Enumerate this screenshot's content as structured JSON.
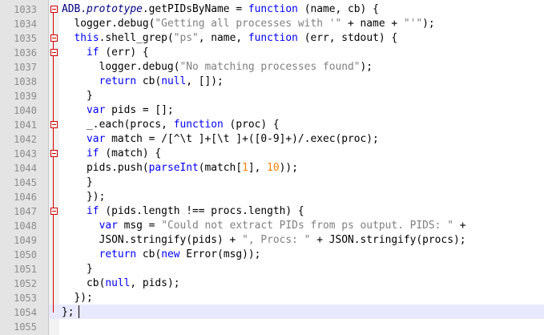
{
  "editor": {
    "caret_line": "1054",
    "lines": [
      {
        "n": "1033",
        "fold": true,
        "tokens": [
          [
            "ADB.",
            "op"
          ],
          [
            "prototype",
            "it"
          ],
          [
            ".getPIDsByName = ",
            ""
          ],
          [
            "function",
            ""
          ],
          [
            " (name, cb) {",
            ""
          ]
        ]
      },
      {
        "n": "1034",
        "fold": false,
        "tokens": [
          [
            "  logger.debug(",
            ""
          ],
          [
            "\"Getting all processes with '\"",
            "str"
          ],
          [
            " + name + ",
            ""
          ],
          [
            "\"'\"",
            "str"
          ],
          [
            ");",
            ""
          ]
        ]
      },
      {
        "n": "1035",
        "fold": true,
        "tokens": [
          [
            "  ",
            ""
          ],
          [
            "this",
            "kw"
          ],
          [
            ".shell_grep(",
            ""
          ],
          [
            "\"ps\"",
            "str"
          ],
          [
            ", name, ",
            ""
          ],
          [
            "function",
            "kw"
          ],
          [
            " (err, stdout) {",
            ""
          ]
        ]
      },
      {
        "n": "1036",
        "fold": true,
        "tokens": [
          [
            "    ",
            ""
          ],
          [
            "if",
            "kw"
          ],
          [
            " (err) {",
            ""
          ]
        ]
      },
      {
        "n": "1037",
        "fold": false,
        "tokens": [
          [
            "      logger.debug(",
            ""
          ],
          [
            "\"No matching processes found\"",
            "str"
          ],
          [
            ");",
            ""
          ]
        ]
      },
      {
        "n": "1038",
        "fold": false,
        "tokens": [
          [
            "      ",
            ""
          ],
          [
            "return",
            "kw"
          ],
          [
            " cb(",
            ""
          ],
          [
            "null",
            "kw"
          ],
          [
            ", []);",
            ""
          ]
        ]
      },
      {
        "n": "1039",
        "fold": false,
        "tokens": [
          [
            "    }",
            ""
          ]
        ]
      },
      {
        "n": "1040",
        "fold": false,
        "tokens": [
          [
            "    ",
            ""
          ],
          [
            "var",
            "kw"
          ],
          [
            " pids = [];",
            ""
          ]
        ]
      },
      {
        "n": "1041",
        "fold": true,
        "tokens": [
          [
            "    _.each(procs, ",
            ""
          ],
          [
            "function",
            "kw"
          ],
          [
            " (proc) {",
            ""
          ]
        ]
      },
      {
        "n": "1042",
        "fold": false,
        "tokens": [
          [
            "    ",
            ""
          ],
          [
            "var",
            "kw"
          ],
          [
            " match = /[^\\t ]+[\\t ]+([0-9]+)/.exec(proc);",
            ""
          ]
        ]
      },
      {
        "n": "1043",
        "fold": true,
        "tokens": [
          [
            "    ",
            ""
          ],
          [
            "if",
            "kw"
          ],
          [
            " (match) {",
            ""
          ]
        ]
      },
      {
        "n": "1044",
        "fold": false,
        "tokens": [
          [
            "    pids.push(",
            ""
          ],
          [
            "parseInt",
            "kw"
          ],
          [
            "(match[",
            ""
          ],
          [
            "1",
            "num"
          ],
          [
            "], ",
            ""
          ],
          [
            "10",
            "num"
          ],
          [
            "));",
            ""
          ]
        ]
      },
      {
        "n": "1045",
        "fold": false,
        "tokens": [
          [
            "    }",
            ""
          ]
        ]
      },
      {
        "n": "1046",
        "fold": false,
        "tokens": [
          [
            "    });",
            ""
          ]
        ]
      },
      {
        "n": "1047",
        "fold": true,
        "tokens": [
          [
            "    ",
            ""
          ],
          [
            "if",
            "kw"
          ],
          [
            " (pids.length !== procs.length) {",
            ""
          ]
        ]
      },
      {
        "n": "1048",
        "fold": false,
        "tokens": [
          [
            "      ",
            ""
          ],
          [
            "var",
            "kw"
          ],
          [
            " msg = ",
            ""
          ],
          [
            "\"Could not extract PIDs from ps output. PIDS: \"",
            "str"
          ],
          [
            " +",
            ""
          ]
        ]
      },
      {
        "n": "1049",
        "fold": false,
        "tokens": [
          [
            "      JSON.stringify(pids) + ",
            ""
          ],
          [
            "\", Procs: \"",
            "str"
          ],
          [
            " + JSON.stringify(procs);",
            ""
          ]
        ]
      },
      {
        "n": "1050",
        "fold": false,
        "tokens": [
          [
            "      ",
            ""
          ],
          [
            "return",
            "kw"
          ],
          [
            " cb(",
            ""
          ],
          [
            "new",
            "kw"
          ],
          [
            " Error(msg));",
            ""
          ]
        ]
      },
      {
        "n": "1051",
        "fold": false,
        "tokens": [
          [
            "    }",
            ""
          ]
        ]
      },
      {
        "n": "1052",
        "fold": false,
        "tokens": [
          [
            "    cb(",
            ""
          ],
          [
            "null",
            "kw"
          ],
          [
            ", pids);",
            ""
          ]
        ]
      },
      {
        "n": "1053",
        "fold": false,
        "tokens": [
          [
            "  });",
            ""
          ]
        ]
      },
      {
        "n": "1054",
        "fold": false,
        "tokens": [
          [
            "};",
            ""
          ]
        ]
      },
      {
        "n": "1055",
        "fold": false,
        "tokens": []
      }
    ]
  }
}
